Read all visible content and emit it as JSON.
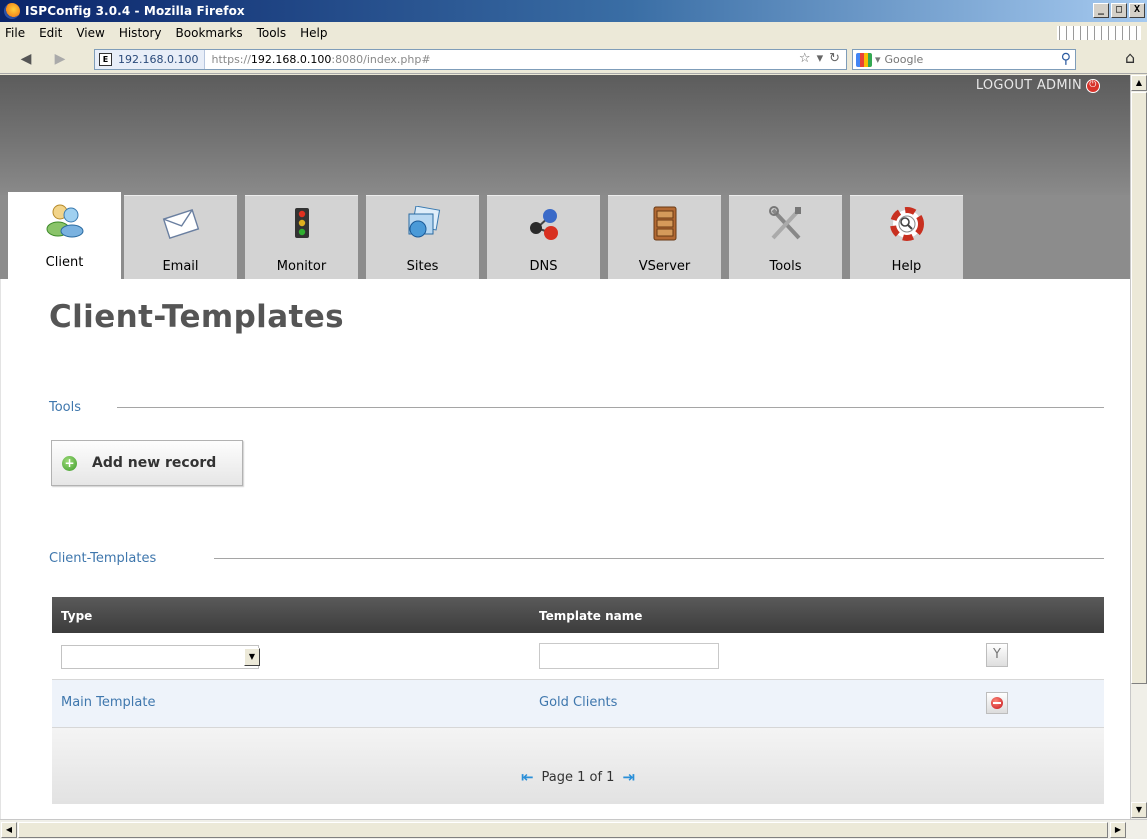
{
  "window": {
    "title": "ISPConfig 3.0.4 - Mozilla Firefox",
    "min": "_",
    "max": "□",
    "close": "X"
  },
  "menu": [
    "File",
    "Edit",
    "View",
    "History",
    "Bookmarks",
    "Tools",
    "Help"
  ],
  "nav": {
    "site_identity": "192.168.0.100",
    "url_scheme": "https://",
    "url_host": "192.168.0.100",
    "url_rest": ":8080/index.php#",
    "search_placeholder": "Google"
  },
  "header": {
    "logout": "LOGOUT ADMIN"
  },
  "tabs": [
    {
      "label": "Client",
      "icon": "client-icon",
      "active": true
    },
    {
      "label": "Email",
      "icon": "email-icon"
    },
    {
      "label": "Monitor",
      "icon": "monitor-icon"
    },
    {
      "label": "Sites",
      "icon": "sites-icon"
    },
    {
      "label": "DNS",
      "icon": "dns-icon"
    },
    {
      "label": "VServer",
      "icon": "vserver-icon"
    },
    {
      "label": "Tools",
      "icon": "tools-icon"
    },
    {
      "label": "Help",
      "icon": "help-icon"
    }
  ],
  "page": {
    "title": "Client-Templates"
  },
  "tools_section": {
    "title": "Tools",
    "add_button": "Add new record"
  },
  "list_section": {
    "title": "Client-Templates"
  },
  "table": {
    "columns": [
      "Type",
      "Template name"
    ],
    "filter": {
      "type_value": "",
      "name_value": ""
    },
    "rows": [
      {
        "type": "Main Template",
        "name": "Gold Clients"
      }
    ],
    "pager": "Page 1 of 1"
  },
  "colors": {
    "link": "#3f77ad",
    "header_dark": "#3c3c3c",
    "row_bg": "#eef3fa"
  }
}
